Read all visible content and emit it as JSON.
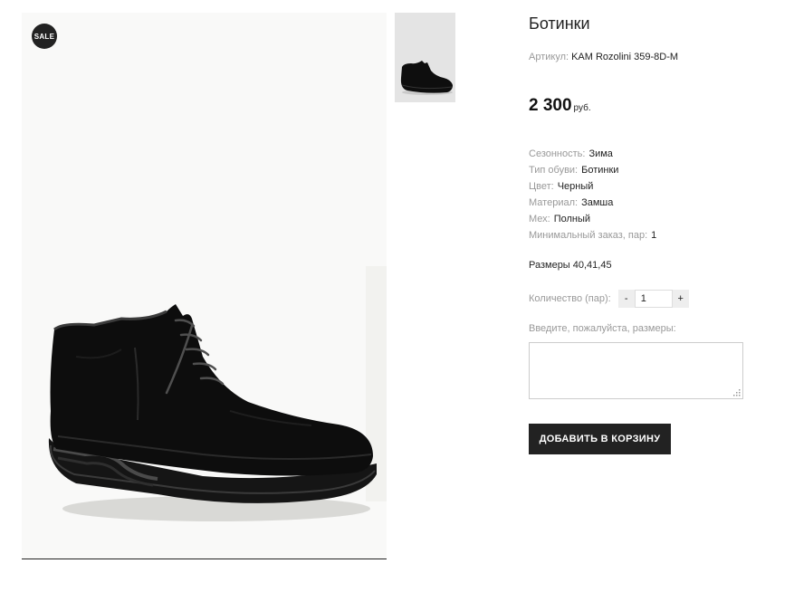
{
  "gallery": {
    "badge": "SALE",
    "main_image": "black-suede-ankle-boot-photo",
    "thumbnail": "black-suede-ankle-boot-thumbnail"
  },
  "product": {
    "title": "Ботинки",
    "sku_label": "Артикул:",
    "sku_value": "KAM Rozolini 359-8D-M",
    "price": "2 300",
    "currency": "руб."
  },
  "properties": [
    {
      "label": "Сезонность:",
      "value": "Зима"
    },
    {
      "label": "Тип обуви:",
      "value": "Ботинки"
    },
    {
      "label": "Цвет:",
      "value": "Черный"
    },
    {
      "label": "Материал:",
      "value": "Замша"
    },
    {
      "label": "Мех:",
      "value": "Полный"
    },
    {
      "label": "Минимальный заказ, пар:",
      "value": "1"
    }
  ],
  "sizes_text": "Размеры 40,41,45",
  "quantity": {
    "label": "Количество (пар):",
    "minus": "-",
    "value": "1",
    "plus": "+"
  },
  "sizes_prompt": "Введите, пожалуйста, размеры:",
  "sizes_input_value": "",
  "add_to_cart": "ДОБАВИТЬ В КОРЗИНУ",
  "colors": {
    "button_bg": "#222222",
    "label": "#999999",
    "text": "#222222"
  }
}
